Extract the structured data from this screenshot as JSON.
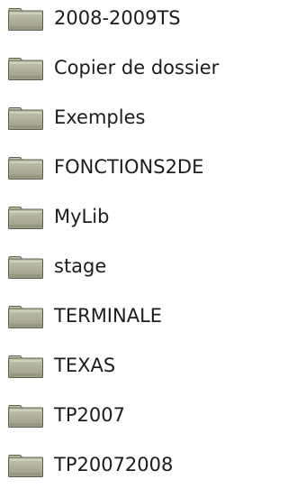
{
  "folders": [
    {
      "name": "2008-2009TS",
      "icon": "folder-icon"
    },
    {
      "name": "Copier de dossier",
      "icon": "folder-icon"
    },
    {
      "name": "Exemples",
      "icon": "folder-icon"
    },
    {
      "name": "FONCTIONS2DE",
      "icon": "folder-icon"
    },
    {
      "name": "MyLib",
      "icon": "folder-icon"
    },
    {
      "name": "stage",
      "icon": "folder-icon"
    },
    {
      "name": "TERMINALE",
      "icon": "folder-icon"
    },
    {
      "name": "TEXAS",
      "icon": "folder-icon"
    },
    {
      "name": "TP2007",
      "icon": "folder-icon"
    },
    {
      "name": "TP20072008",
      "icon": "folder-icon"
    }
  ],
  "colors": {
    "folder_body": "#a9aa93",
    "folder_tab": "#c9cab4",
    "folder_outline": "#5c5d4c",
    "label_text": "#1c1c1c"
  }
}
